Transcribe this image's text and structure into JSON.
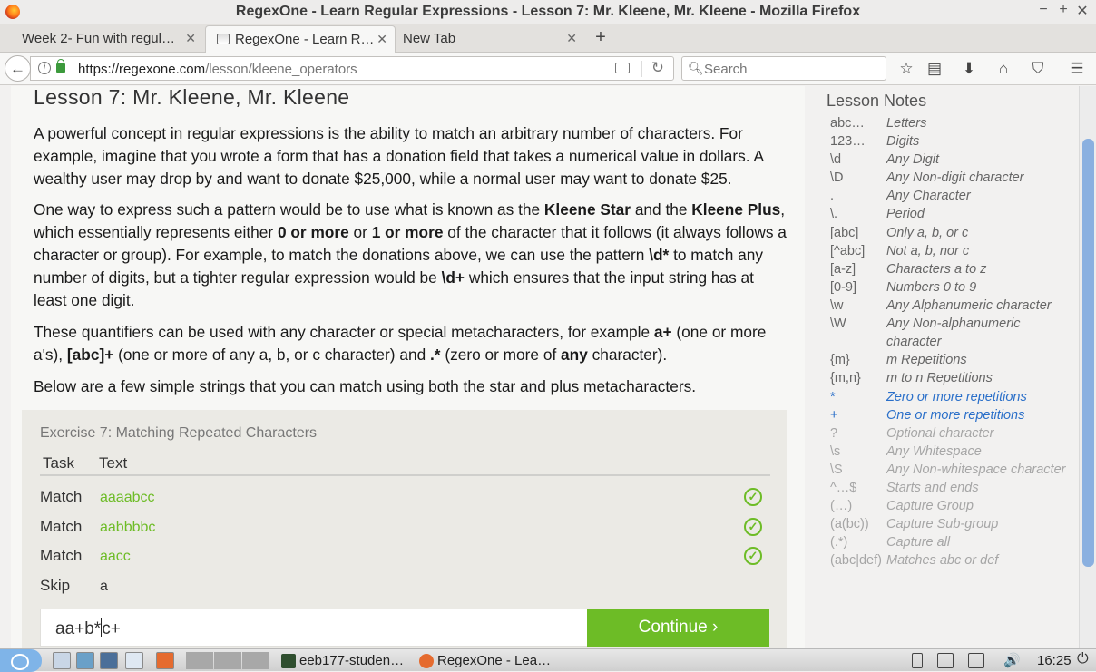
{
  "window": {
    "title": "RegexOne - Learn Regular Expressions - Lesson 7: Mr. Kleene, Mr. Kleene - Mozilla Firefox",
    "minimize": "−",
    "maximize": "+",
    "close": "✕"
  },
  "tabs": [
    {
      "label": "Week 2- Fun with regul…",
      "close": "✕"
    },
    {
      "label": "RegexOne - Learn R…",
      "close": "✕"
    },
    {
      "label": "New Tab",
      "close": "✕"
    }
  ],
  "toolbar": {
    "url_host": "https://regexone.com",
    "url_path": "/lesson/kleene_operators",
    "search_placeholder": "Search",
    "back_glyph": "←"
  },
  "lesson": {
    "title": "Lesson 7: Mr. Kleene, Mr. Kleene",
    "p1": "A powerful concept in regular expressions is the ability to match an arbitrary number of characters. For example, imagine that you wrote a form that has a donation field that takes a numerical value in dollars. A wealthy user may drop by and want to donate $25,000, while a normal user may want to donate $25.",
    "p2_a": "One way to express such a pattern would be to use what is known as the ",
    "p2_b": "Kleene Star",
    "p2_c": " and the ",
    "p2_d": "Kleene Plus",
    "p2_e": ", which essentially represents either ",
    "p2_f": "0 or more",
    "p2_g": " or ",
    "p2_h": "1 or more",
    "p2_i": " of the character that it follows (it always follows a character or group). For example, to match the donations above, we can use the pattern ",
    "p2_j": "\\d*",
    "p2_k": " to match any number of digits, but a tighter regular expression would be ",
    "p2_l": "\\d+",
    "p2_m": " which ensures that the input string has at least one digit.",
    "p3_a": "These quantifiers can be used with any character or special metacharacters, for example ",
    "p3_b": "a+",
    "p3_c": " (one or more a's), ",
    "p3_d": "[abc]+",
    "p3_e": " (one or more of any a, b, or c character) and ",
    "p3_f": ".*",
    "p3_g": " (zero or more of ",
    "p3_h": "any",
    "p3_i": " character).",
    "p4": "Below are a few simple strings that you can match using both the star and plus metacharacters."
  },
  "exercise": {
    "title": "Exercise 7: Matching Repeated Characters",
    "col_task": "Task",
    "col_text": "Text",
    "rows": [
      {
        "task": "Match",
        "text": "aaaabcc",
        "status": "✓"
      },
      {
        "task": "Match",
        "text": "aabbbbc",
        "status": "✓"
      },
      {
        "task": "Match",
        "text": "aacc",
        "status": "✓"
      },
      {
        "task": "Skip",
        "text": "a",
        "status": ""
      }
    ],
    "answer_before_caret": "aa+b*",
    "answer_after_caret": "c+",
    "continue_label": "Continue ›",
    "accent": "#6dbc26"
  },
  "notes": {
    "title": "Lesson Notes",
    "items": [
      {
        "k": "abc…",
        "v": "Letters"
      },
      {
        "k": "123…",
        "v": "Digits"
      },
      {
        "k": "\\d",
        "v": "Any Digit"
      },
      {
        "k": "\\D",
        "v": "Any Non-digit character"
      },
      {
        "k": ".",
        "v": "Any Character"
      },
      {
        "k": "\\.",
        "v": "Period"
      },
      {
        "k": "[abc]",
        "v": "Only a, b, or c"
      },
      {
        "k": "[^abc]",
        "v": "Not a, b, nor c"
      },
      {
        "k": "[a-z]",
        "v": "Characters a to z"
      },
      {
        "k": "[0-9]",
        "v": "Numbers 0 to 9"
      },
      {
        "k": "\\w",
        "v": "Any Alphanumeric character"
      },
      {
        "k": "\\W",
        "v": "Any Non-alphanumeric character"
      },
      {
        "k": "{m}",
        "v": "m Repetitions"
      },
      {
        "k": "{m,n}",
        "v": "m to n Repetitions"
      },
      {
        "k": "*",
        "v": "Zero or more repetitions"
      },
      {
        "k": "+",
        "v": "One or more repetitions"
      },
      {
        "k": "?",
        "v": "Optional character"
      },
      {
        "k": "\\s",
        "v": "Any Whitespace"
      },
      {
        "k": "\\S",
        "v": "Any Non-whitespace character"
      },
      {
        "k": "^…$",
        "v": "Starts and ends"
      },
      {
        "k": "(…)",
        "v": "Capture Group"
      },
      {
        "k": "(a(bc))",
        "v": "Capture Sub-group"
      },
      {
        "k": "(.*)",
        "v": "Capture all"
      },
      {
        "k": "(abc|def)",
        "v": "Matches abc or def"
      }
    ]
  },
  "taskbar": {
    "app1": "eeb177-studen…",
    "app2": "RegexOne - Lea…",
    "clock": "16:25",
    "power_glyph": "⏻",
    "volume_glyph": "🔊"
  }
}
